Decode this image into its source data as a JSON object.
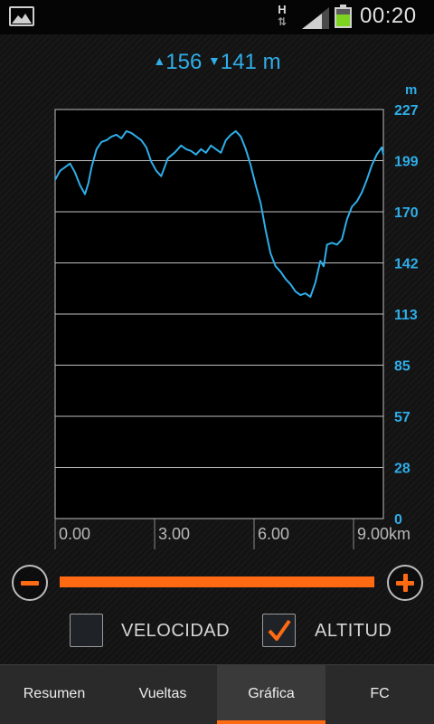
{
  "status_bar": {
    "time": "00:20",
    "network_type": "H",
    "icons": [
      "gallery-notification-icon",
      "data-transfer-icon",
      "signal-icon",
      "battery-icon"
    ],
    "battery_color": "#7ed321"
  },
  "elevation_summary": {
    "ascent_marker": "▲",
    "ascent_value": "156",
    "descent_marker": "▼",
    "descent_value": "141",
    "unit": "m"
  },
  "chart_data": {
    "type": "line",
    "title": "",
    "ylabel": "m",
    "xlabel": "km",
    "ylim": [
      0,
      227
    ],
    "xlim": [
      0,
      9.9
    ],
    "y_ticks": [
      "227",
      "199",
      "170",
      "142",
      "113",
      "85",
      "57",
      "28",
      "0"
    ],
    "x_ticks": [
      "0.00",
      "3.00",
      "6.00",
      "9.00km"
    ],
    "line_color": "#2faee9",
    "grid": true,
    "series": [
      {
        "name": "",
        "x": [
          0.0,
          0.15,
          0.3,
          0.45,
          0.6,
          0.75,
          0.9,
          1.0,
          1.1,
          1.25,
          1.4,
          1.55,
          1.7,
          1.85,
          2.0,
          2.15,
          2.3,
          2.45,
          2.6,
          2.75,
          2.9,
          3.05,
          3.2,
          3.4,
          3.6,
          3.8,
          3.95,
          4.1,
          4.25,
          4.4,
          4.55,
          4.7,
          4.85,
          5.0,
          5.15,
          5.3,
          5.45,
          5.6,
          5.75,
          5.9,
          6.05,
          6.2,
          6.35,
          6.5,
          6.65,
          6.8,
          6.95,
          7.1,
          7.25,
          7.4,
          7.55,
          7.7,
          7.85,
          8.0,
          8.1,
          8.2,
          8.35,
          8.5,
          8.65,
          8.8,
          8.95,
          9.1,
          9.25,
          9.4,
          9.55,
          9.7,
          9.85,
          9.9
        ],
        "values": [
          188,
          193,
          195,
          197,
          192,
          185,
          180,
          186,
          195,
          205,
          209,
          210,
          212,
          213,
          211,
          215,
          214,
          212,
          210,
          206,
          198,
          193,
          190,
          200,
          203,
          207,
          205,
          204,
          202,
          205,
          203,
          207,
          205,
          203,
          210,
          213,
          215,
          212,
          205,
          196,
          185,
          175,
          160,
          147,
          140,
          137,
          133,
          130,
          126,
          124,
          125,
          123,
          131,
          143,
          140,
          152,
          153,
          152,
          155,
          166,
          173,
          176,
          181,
          188,
          196,
          202,
          206,
          202
        ]
      }
    ]
  },
  "controls": {
    "velocity_label": "VELOCIDAD",
    "velocity_checked": false,
    "altitude_label": "ALTITUD",
    "altitude_checked": true,
    "accent_color": "#ff6a13"
  },
  "tabs": [
    {
      "label": "Resumen",
      "active": false
    },
    {
      "label": "Vueltas",
      "active": false
    },
    {
      "label": "Gráfica",
      "active": true
    },
    {
      "label": "FC",
      "active": false
    }
  ]
}
